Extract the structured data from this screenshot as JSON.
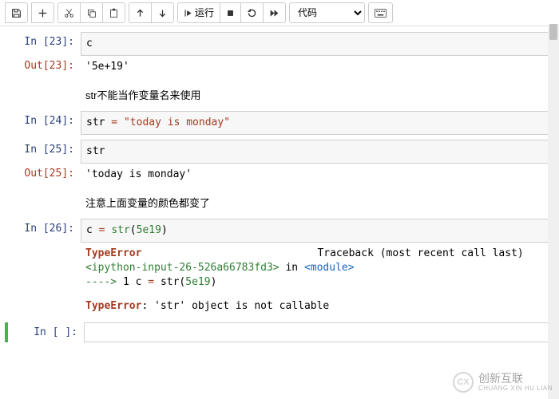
{
  "toolbar": {
    "run_label": "运行",
    "celltype_label": "代码"
  },
  "cells": [
    {
      "in_label": "In  [23]:",
      "code_plain": "c",
      "out_label": "Out[23]:",
      "out_value": "'5e+19'"
    },
    {
      "md_text": "str不能当作变量名来使用"
    },
    {
      "in_label": "In  [24]:",
      "code_tokens": {
        "lhs": "str",
        "op": " = ",
        "str": "\"today is monday\""
      }
    },
    {
      "in_label": "In  [25]:",
      "code_plain": "str",
      "out_label": "Out[25]:",
      "out_value": "'today is monday'"
    },
    {
      "md_text": "注意上面变量的颜色都变了"
    },
    {
      "in_label": "In  [26]:",
      "code_tokens": {
        "lhs": "c",
        "op": " = ",
        "fn": "str",
        "lp": "(",
        "num": "5e19",
        "rp": ")"
      },
      "error": {
        "name1": "TypeError",
        "traceback": "Traceback (most recent call last)",
        "loc": "<ipython-input-26-526a66783fd3>",
        "in_word": " in ",
        "module": "<module>",
        "arrow": "----> ",
        "lineno": "1 ",
        "code_echo": {
          "lhs": "c ",
          "op": "=",
          "sp": " ",
          "fn": "str",
          "lp": "(",
          "num": "5e19",
          "rp": ")"
        },
        "name2": "TypeError",
        "msg": ": 'str' object is not callable"
      }
    },
    {
      "in_label": "In  [ ]:",
      "code_plain": ""
    }
  ],
  "watermark": {
    "logo": "CX",
    "line1": "创新互联",
    "line2": "CHUANG XIN HU LIAN"
  }
}
